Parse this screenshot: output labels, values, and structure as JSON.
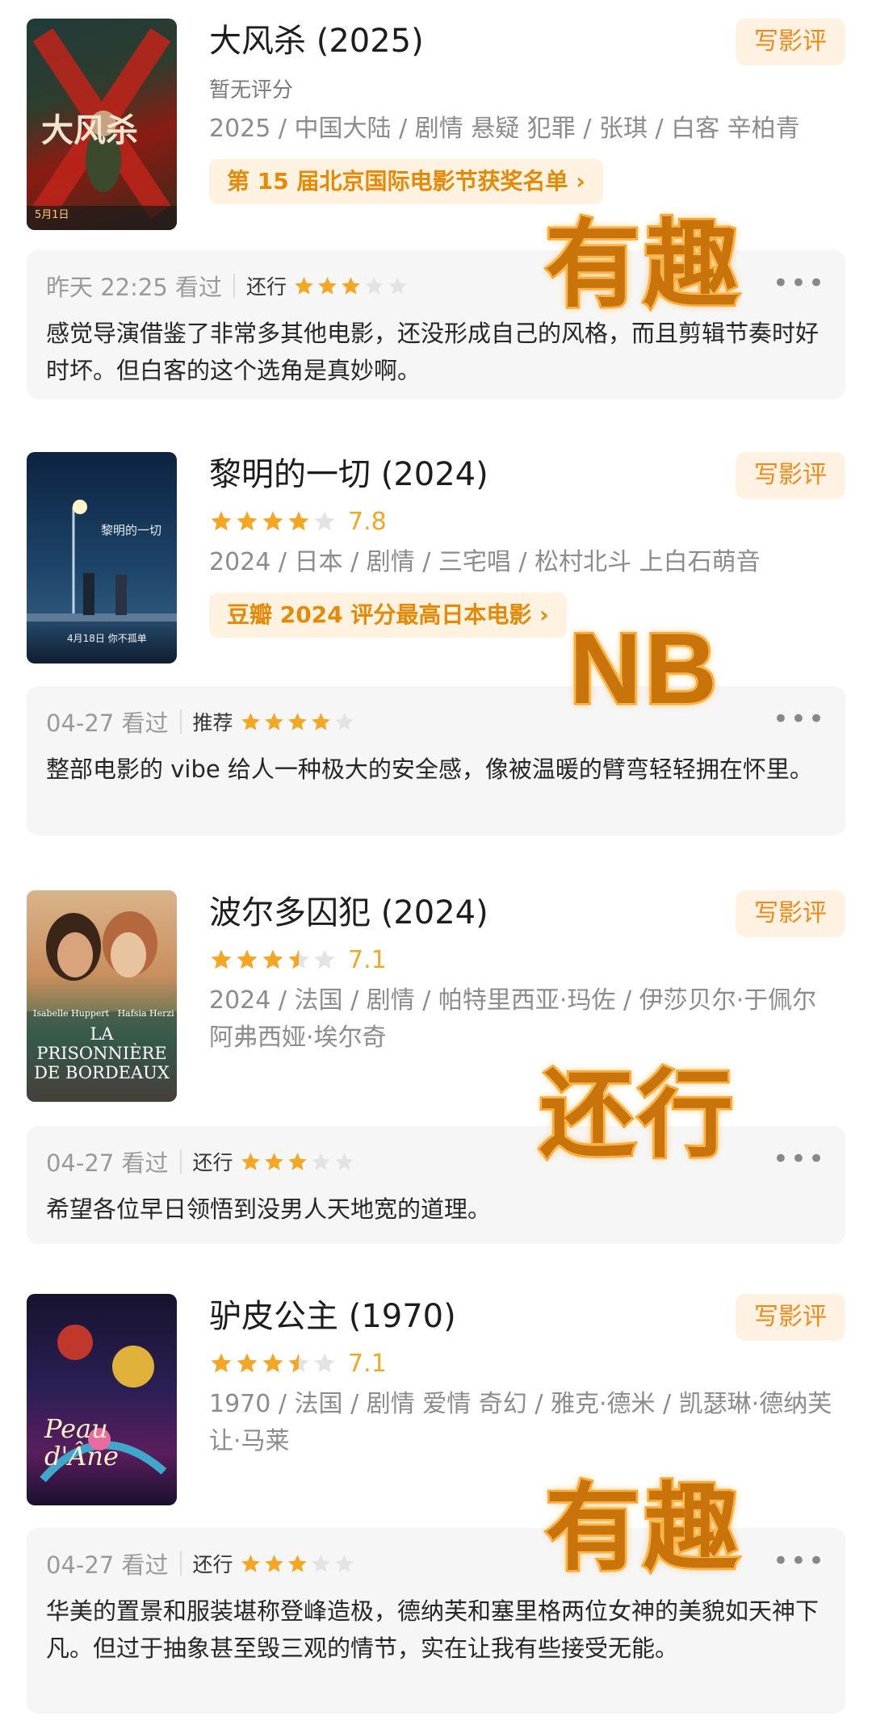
{
  "movies": [
    {
      "title": "大风杀 (2025)",
      "rating_text": "暂无评分",
      "meta": "2025 / 中国大陆 / 剧情 悬疑 犯罪 / 张琪 / 白客 辛柏青",
      "promo": "第 15 届北京国际电影节获奖名单 ›",
      "write_review": "写影评",
      "poster_text": "大风杀",
      "poster_date": "5月1日",
      "review": {
        "date": "昨天 22:25 看过",
        "tag": "还行",
        "stars": 3,
        "text": "感觉导演借鉴了非常多其他电影，还没形成自己的风格，而且剪辑节奏时好时坏。但白客的这个选角是真妙啊。"
      },
      "overlay": "有趣"
    },
    {
      "title": "黎明的一切 (2024)",
      "score": "7.8",
      "rating_stars": 4,
      "meta": "2024 / 日本 / 剧情 / 三宅唱 / 松村北斗 上白石萌音",
      "promo": "豆瓣 2024 评分最高日本电影 ›",
      "write_review": "写影评",
      "poster_text": "黎明的一切",
      "poster_date": "4月18日 你不孤单",
      "review": {
        "date": "04-27 看过",
        "tag": "推荐",
        "stars": 4,
        "text": "整部电影的 vibe 给人一种极大的安全感，像被温暖的臂弯轻轻拥在怀里。"
      },
      "overlay": "NB"
    },
    {
      "title": "波尔多囚犯 (2024)",
      "score": "7.1",
      "rating_stars": 3.5,
      "meta": "2024 / 法国 / 剧情 / 帕特里西亚·玛佐 / 伊莎贝尔·于佩尔 阿弗西娅·埃尔奇",
      "write_review": "写影评",
      "poster_text": "LA PRISONNIÈRE DE BORDEAUX",
      "poster_names": "Isabelle Huppert   Hafsia Herzi",
      "review": {
        "date": "04-27 看过",
        "tag": "还行",
        "stars": 3,
        "text": "希望各位早日领悟到没男人天地宽的道理。"
      },
      "overlay": "还行"
    },
    {
      "title": "驴皮公主 (1970)",
      "score": "7.1",
      "rating_stars": 3.5,
      "meta": "1970 / 法国 / 剧情 爱情 奇幻 / 雅克·德米 / 凯瑟琳·德纳芙 让·马莱",
      "write_review": "写影评",
      "poster_text": "Peau d'Âne",
      "review": {
        "date": "04-27 看过",
        "tag": "还行",
        "stars": 3,
        "text": "华美的置景和服装堪称登峰造极，德纳芙和塞里格两位女神的美貌如天神下凡。但过于抽象甚至毁三观的情节，实在让我有些接受无能。"
      },
      "overlay": "有趣"
    }
  ],
  "icons": {
    "more": "more-dots-icon",
    "star": "star-icon"
  },
  "colors": {
    "star": "#f5a623",
    "star_empty": "#e3e3e3",
    "accent": "#ef8a1a"
  }
}
